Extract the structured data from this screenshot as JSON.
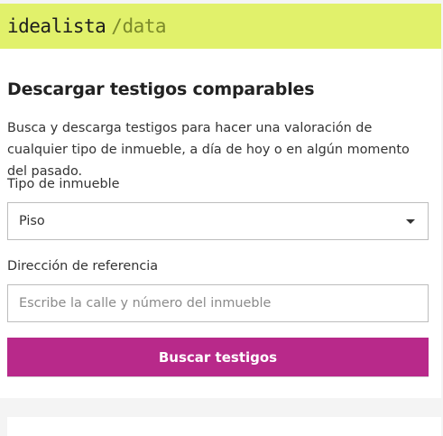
{
  "brand": {
    "name": "idealista",
    "suffix": "/data"
  },
  "form": {
    "title": "Descargar testigos comparables",
    "description": "Busca y descarga testigos para hacer una valoración de cualquier tipo de inmueble, a día de hoy o en algún momento del pasado.",
    "property_type": {
      "label": "Tipo de inmueble",
      "value": "Piso"
    },
    "address": {
      "label": "Dirección de referencia",
      "placeholder": "Escribe la calle y número del inmueble",
      "value": ""
    },
    "submit_label": "Buscar testigos"
  },
  "colors": {
    "header_bg": "#e1f16b",
    "brand_suffix": "#7c8a2a",
    "button_bg": "#b8298a",
    "page_bg": "#f4f4f4"
  },
  "icons": {
    "select_caret": "caret-down-icon"
  }
}
